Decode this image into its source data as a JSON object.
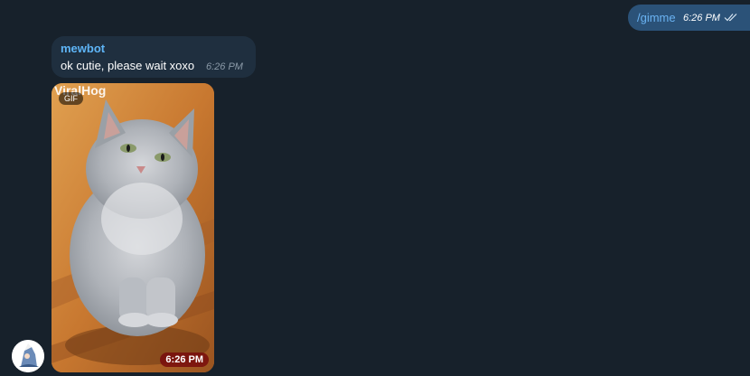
{
  "outgoing": {
    "text": "/gimme",
    "time": "6:26 PM",
    "status_icon": "double-check-icon"
  },
  "incoming": {
    "sender": "mewbot",
    "text": "ok cutie, please wait xoxo",
    "time": "6:26 PM"
  },
  "gif": {
    "badge": "GIF",
    "watermark": "ViralHog",
    "time": "6:26 PM"
  },
  "avatar": {
    "icon": "bot-avatar-icon"
  },
  "colors": {
    "background": "#17212b",
    "outgoing_bubble": "#2b5278",
    "incoming_bubble": "#1f2f3f",
    "sender_name": "#5eb5f7",
    "command_link": "#6ab3f3"
  }
}
